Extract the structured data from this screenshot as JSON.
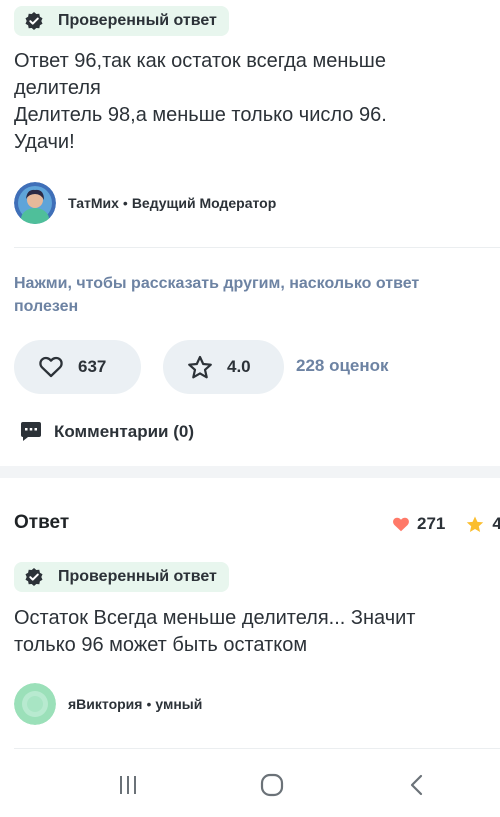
{
  "answer1": {
    "badge": "Проверенный ответ",
    "lines": [
      "Ответ 96,так как остаток всегда меньше",
      "делителя",
      "Делитель 98,а меньше только число 96.",
      "Удачи!"
    ],
    "author": {
      "name": "ТатМих",
      "separator": "•",
      "rank": "Ведущий Модератор"
    }
  },
  "feedback": {
    "prompt_line1": "Нажми, чтобы рассказать другим, насколько ответ",
    "prompt_line2": "полезен",
    "likes": "637",
    "rating": "4.0",
    "ratings_count": "228 оценок"
  },
  "comments": {
    "label": "Комментарии (0)"
  },
  "answer2": {
    "heading": "Ответ",
    "likes": "271",
    "rating": "4",
    "badge": "Проверенный ответ",
    "lines": [
      "Остаток Всегда меньше делителя... Значит",
      "только 96 может быть остатком"
    ],
    "author": {
      "name": "яВиктория",
      "separator": "•",
      "rank": "умный"
    }
  },
  "colors": {
    "verified_bg": "#e8f6ee",
    "accent_blue": "#6d83a3",
    "heart_red": "#ff7968",
    "star_yellow": "#fbbe2e"
  },
  "icons": [
    "verified-check-icon",
    "heart-outline-icon",
    "star-outline-icon",
    "comment-icon",
    "heart-filled-icon",
    "star-filled-icon",
    "recent-apps-icon",
    "home-icon",
    "back-icon"
  ]
}
